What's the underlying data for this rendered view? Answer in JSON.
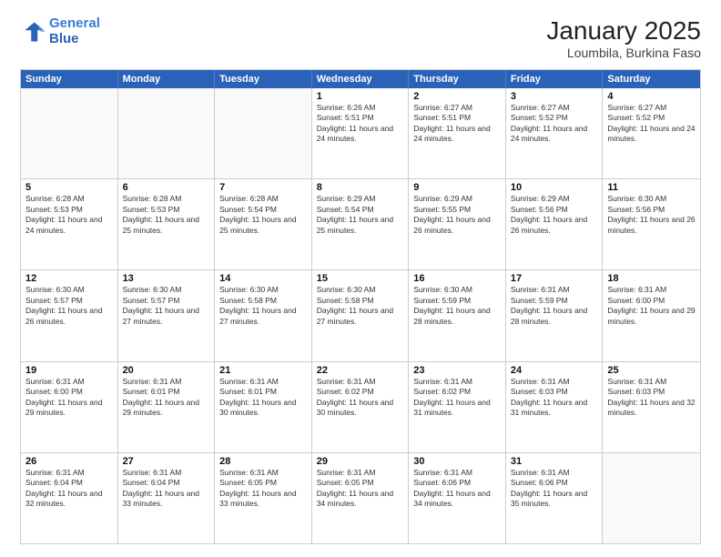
{
  "header": {
    "logo_line1": "General",
    "logo_line2": "Blue",
    "title": "January 2025",
    "subtitle": "Loumbila, Burkina Faso"
  },
  "days_of_week": [
    "Sunday",
    "Monday",
    "Tuesday",
    "Wednesday",
    "Thursday",
    "Friday",
    "Saturday"
  ],
  "weeks": [
    [
      {
        "day": "",
        "info": ""
      },
      {
        "day": "",
        "info": ""
      },
      {
        "day": "",
        "info": ""
      },
      {
        "day": "1",
        "info": "Sunrise: 6:26 AM\nSunset: 5:51 PM\nDaylight: 11 hours and 24 minutes."
      },
      {
        "day": "2",
        "info": "Sunrise: 6:27 AM\nSunset: 5:51 PM\nDaylight: 11 hours and 24 minutes."
      },
      {
        "day": "3",
        "info": "Sunrise: 6:27 AM\nSunset: 5:52 PM\nDaylight: 11 hours and 24 minutes."
      },
      {
        "day": "4",
        "info": "Sunrise: 6:27 AM\nSunset: 5:52 PM\nDaylight: 11 hours and 24 minutes."
      }
    ],
    [
      {
        "day": "5",
        "info": "Sunrise: 6:28 AM\nSunset: 5:53 PM\nDaylight: 11 hours and 24 minutes."
      },
      {
        "day": "6",
        "info": "Sunrise: 6:28 AM\nSunset: 5:53 PM\nDaylight: 11 hours and 25 minutes."
      },
      {
        "day": "7",
        "info": "Sunrise: 6:28 AM\nSunset: 5:54 PM\nDaylight: 11 hours and 25 minutes."
      },
      {
        "day": "8",
        "info": "Sunrise: 6:29 AM\nSunset: 5:54 PM\nDaylight: 11 hours and 25 minutes."
      },
      {
        "day": "9",
        "info": "Sunrise: 6:29 AM\nSunset: 5:55 PM\nDaylight: 11 hours and 26 minutes."
      },
      {
        "day": "10",
        "info": "Sunrise: 6:29 AM\nSunset: 5:56 PM\nDaylight: 11 hours and 26 minutes."
      },
      {
        "day": "11",
        "info": "Sunrise: 6:30 AM\nSunset: 5:56 PM\nDaylight: 11 hours and 26 minutes."
      }
    ],
    [
      {
        "day": "12",
        "info": "Sunrise: 6:30 AM\nSunset: 5:57 PM\nDaylight: 11 hours and 26 minutes."
      },
      {
        "day": "13",
        "info": "Sunrise: 6:30 AM\nSunset: 5:57 PM\nDaylight: 11 hours and 27 minutes."
      },
      {
        "day": "14",
        "info": "Sunrise: 6:30 AM\nSunset: 5:58 PM\nDaylight: 11 hours and 27 minutes."
      },
      {
        "day": "15",
        "info": "Sunrise: 6:30 AM\nSunset: 5:58 PM\nDaylight: 11 hours and 27 minutes."
      },
      {
        "day": "16",
        "info": "Sunrise: 6:30 AM\nSunset: 5:59 PM\nDaylight: 11 hours and 28 minutes."
      },
      {
        "day": "17",
        "info": "Sunrise: 6:31 AM\nSunset: 5:59 PM\nDaylight: 11 hours and 28 minutes."
      },
      {
        "day": "18",
        "info": "Sunrise: 6:31 AM\nSunset: 6:00 PM\nDaylight: 11 hours and 29 minutes."
      }
    ],
    [
      {
        "day": "19",
        "info": "Sunrise: 6:31 AM\nSunset: 6:00 PM\nDaylight: 11 hours and 29 minutes."
      },
      {
        "day": "20",
        "info": "Sunrise: 6:31 AM\nSunset: 6:01 PM\nDaylight: 11 hours and 29 minutes."
      },
      {
        "day": "21",
        "info": "Sunrise: 6:31 AM\nSunset: 6:01 PM\nDaylight: 11 hours and 30 minutes."
      },
      {
        "day": "22",
        "info": "Sunrise: 6:31 AM\nSunset: 6:02 PM\nDaylight: 11 hours and 30 minutes."
      },
      {
        "day": "23",
        "info": "Sunrise: 6:31 AM\nSunset: 6:02 PM\nDaylight: 11 hours and 31 minutes."
      },
      {
        "day": "24",
        "info": "Sunrise: 6:31 AM\nSunset: 6:03 PM\nDaylight: 11 hours and 31 minutes."
      },
      {
        "day": "25",
        "info": "Sunrise: 6:31 AM\nSunset: 6:03 PM\nDaylight: 11 hours and 32 minutes."
      }
    ],
    [
      {
        "day": "26",
        "info": "Sunrise: 6:31 AM\nSunset: 6:04 PM\nDaylight: 11 hours and 32 minutes."
      },
      {
        "day": "27",
        "info": "Sunrise: 6:31 AM\nSunset: 6:04 PM\nDaylight: 11 hours and 33 minutes."
      },
      {
        "day": "28",
        "info": "Sunrise: 6:31 AM\nSunset: 6:05 PM\nDaylight: 11 hours and 33 minutes."
      },
      {
        "day": "29",
        "info": "Sunrise: 6:31 AM\nSunset: 6:05 PM\nDaylight: 11 hours and 34 minutes."
      },
      {
        "day": "30",
        "info": "Sunrise: 6:31 AM\nSunset: 6:06 PM\nDaylight: 11 hours and 34 minutes."
      },
      {
        "day": "31",
        "info": "Sunrise: 6:31 AM\nSunset: 6:06 PM\nDaylight: 11 hours and 35 minutes."
      },
      {
        "day": "",
        "info": ""
      }
    ]
  ]
}
